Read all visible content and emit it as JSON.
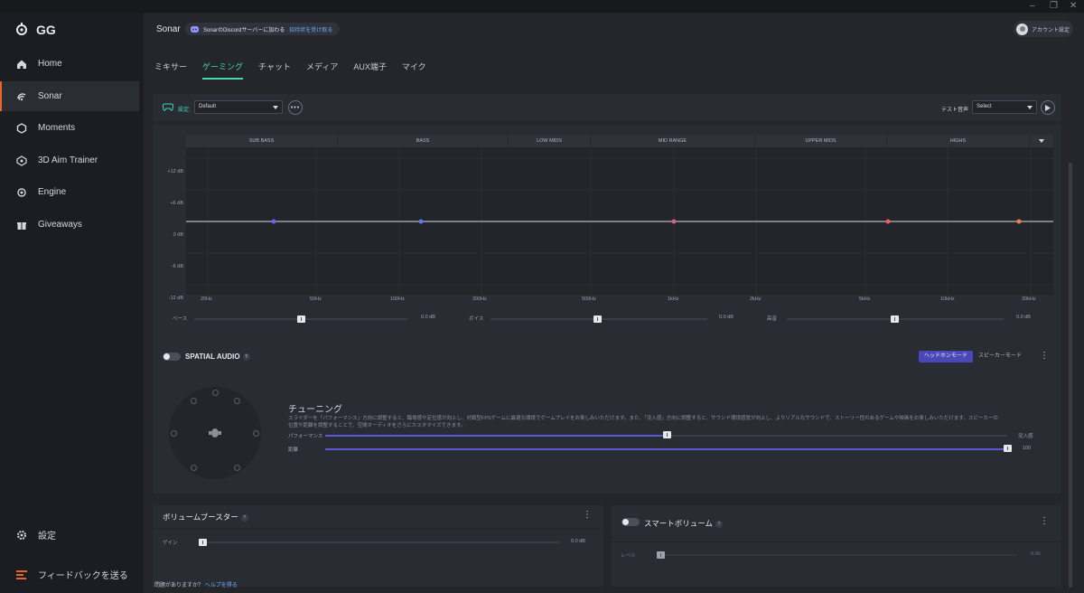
{
  "window": {
    "minimize": "–",
    "restore": "❐",
    "close": "✕"
  },
  "app": {
    "logo_text": "GG"
  },
  "sidebar": {
    "items": [
      {
        "label": "Home",
        "icon": "home-icon"
      },
      {
        "label": "Sonar",
        "icon": "sonar-icon"
      },
      {
        "label": "Moments",
        "icon": "moments-icon"
      },
      {
        "label": "3D Aim Trainer",
        "icon": "aim-icon"
      },
      {
        "label": "Engine",
        "icon": "engine-icon"
      },
      {
        "label": "Giveaways",
        "icon": "gift-icon"
      }
    ],
    "settings_label": "設定",
    "feedback_label": "フィードバックを送る"
  },
  "header": {
    "title": "Sonar",
    "discord_text": "SonarのDiscordサーバーに加わる",
    "discord_link": "招待状を受け取る",
    "account_label": "アカウント設定"
  },
  "tabs": [
    "ミキサー",
    "ゲーミング",
    "チャット",
    "メディア",
    "AUX端子",
    "マイク"
  ],
  "toolbar": {
    "preset_label": "設定:",
    "preset_value": "Default",
    "test_sound_label": "テスト音声",
    "test_sound_value": "Select"
  },
  "eq": {
    "bands": [
      "SUB BASS",
      "BASS",
      "LOW MIDS",
      "MID RANGE",
      "UPPER MIDS",
      "HIGHS"
    ],
    "db_labels": [
      "+12 dB",
      "+6 dB",
      "0 dB",
      "-6 dB",
      "-12 dB"
    ],
    "hz_labels": [
      "20Hz",
      "50Hz",
      "100Hz",
      "200Hz",
      "500Hz",
      "1kHz",
      "2kHz",
      "5kHz",
      "10kHz",
      "20kHz"
    ],
    "sliders": [
      {
        "label": "ベース",
        "value": "0.0 dB"
      },
      {
        "label": "ボイス",
        "value": "0.0 dB"
      },
      {
        "label": "高音",
        "value": "0.0 dB"
      }
    ],
    "point_colors": [
      "#7b5cf0",
      "#5a7cf0",
      "#e05aa0",
      "#f0605a",
      "#f0804a"
    ]
  },
  "spatial": {
    "title": "SPATIAL AUDIO",
    "help": "?",
    "mode_headphone": "ヘッドホンモード",
    "mode_speaker": "スピーカーモード",
    "tuning_title": "チューニング",
    "tuning_desc": "スライダーを「パフォーマンス」方向に調整すると、臨場感や定位感が向上し、対戦型FPSゲームに最適な環境でゲームプレイをお楽しみいただけます。また、「没入感」方向に調整すると、サウンド環境感覚が向上し、よりリアルなサウンドで、ストーリー性のあるゲームや映画をお楽しみいただけます。スピーカーの位置や距離を調整することで、空間オーディオをさらにカスタマイズできます。",
    "perf_label": "パフォーマンス",
    "immersion_label": "没入感",
    "dist_label": "距離",
    "dist_value": "100",
    "tuning_position": 0.5,
    "distance_position": 1.0
  },
  "volume_booster": {
    "title": "ボリュームブースター",
    "help": "?",
    "gain_label": "ゲイン",
    "gain_value": "0.0 dB"
  },
  "smart_volume": {
    "title": "スマートボリューム",
    "help": "?",
    "level_label": "レベル",
    "level_value": "0.00"
  },
  "footer": {
    "question": "問題がありますか？",
    "help_link": "ヘルプを得る"
  }
}
